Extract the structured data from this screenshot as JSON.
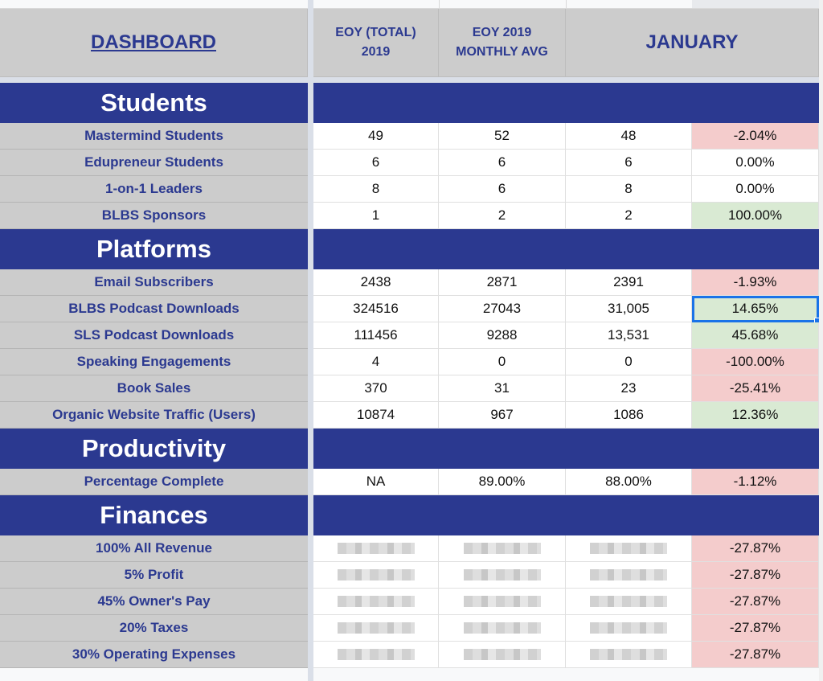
{
  "header": {
    "dashboard_label": "DASHBOARD",
    "col_eoy_total": "EOY (TOTAL) 2019",
    "col_eoy_total_line1": "EOY (TOTAL)",
    "col_eoy_total_line2": "2019",
    "col_monthly_avg_line1": "EOY 2019",
    "col_monthly_avg_line2": "MONTHLY AVG",
    "col_january": "JANUARY"
  },
  "colors": {
    "navy": "#2b3990",
    "label_bg": "#cccccc",
    "negative_bg": "#f4cccc",
    "positive_bg": "#d9ead3",
    "selection": "#1a73e8"
  },
  "sections": [
    {
      "title": "Students",
      "rows": [
        {
          "label": "Mastermind Students",
          "eoy_total": "49",
          "monthly_avg": "52",
          "january": "48",
          "change": "-2.04%",
          "status": "negative"
        },
        {
          "label": "Edupreneur Students",
          "eoy_total": "6",
          "monthly_avg": "6",
          "january": "6",
          "change": "0.00%",
          "status": "neutral"
        },
        {
          "label": "1-on-1 Leaders",
          "eoy_total": "8",
          "monthly_avg": "6",
          "january": "8",
          "change": "0.00%",
          "status": "neutral"
        },
        {
          "label": "BLBS Sponsors",
          "eoy_total": "1",
          "monthly_avg": "2",
          "january": "2",
          "change": "100.00%",
          "status": "positive"
        }
      ]
    },
    {
      "title": "Platforms",
      "rows": [
        {
          "label": "Email Subscribers",
          "eoy_total": "2438",
          "monthly_avg": "2871",
          "january": "2391",
          "change": "-1.93%",
          "status": "negative"
        },
        {
          "label": "BLBS Podcast Downloads",
          "eoy_total": "324516",
          "monthly_avg": "27043",
          "january": "31,005",
          "change": "14.65%",
          "status": "positive",
          "selected": true
        },
        {
          "label": "SLS Podcast Downloads",
          "eoy_total": "111456",
          "monthly_avg": "9288",
          "january": "13,531",
          "change": "45.68%",
          "status": "positive"
        },
        {
          "label": "Speaking Engagements",
          "eoy_total": "4",
          "monthly_avg": "0",
          "january": "0",
          "change": "-100.00%",
          "status": "negative"
        },
        {
          "label": "Book Sales",
          "eoy_total": "370",
          "monthly_avg": "31",
          "january": "23",
          "change": "-25.41%",
          "status": "negative"
        },
        {
          "label": "Organic Website Traffic (Users)",
          "eoy_total": "10874",
          "monthly_avg": "967",
          "january": "1086",
          "change": "12.36%",
          "status": "positive"
        }
      ]
    },
    {
      "title": "Productivity",
      "rows": [
        {
          "label": "Percentage Complete",
          "eoy_total": "NA",
          "monthly_avg": "89.00%",
          "january": "88.00%",
          "change": "-1.12%",
          "status": "negative"
        }
      ]
    },
    {
      "title": "Finances",
      "rows": [
        {
          "label": "100% All Revenue",
          "eoy_total": "",
          "monthly_avg": "",
          "january": "",
          "change": "-27.87%",
          "status": "negative",
          "redacted": true
        },
        {
          "label": "5% Profit",
          "eoy_total": "",
          "monthly_avg": "",
          "january": "",
          "change": "-27.87%",
          "status": "negative",
          "redacted": true
        },
        {
          "label": "45% Owner's Pay",
          "eoy_total": "",
          "monthly_avg": "",
          "january": "",
          "change": "-27.87%",
          "status": "negative",
          "redacted": true
        },
        {
          "label": "20% Taxes",
          "eoy_total": "",
          "monthly_avg": "",
          "january": "",
          "change": "-27.87%",
          "status": "negative",
          "redacted": true
        },
        {
          "label": "30% Operating Expenses",
          "eoy_total": "",
          "monthly_avg": "",
          "january": "",
          "change": "-27.87%",
          "status": "negative",
          "redacted": true
        }
      ]
    }
  ]
}
